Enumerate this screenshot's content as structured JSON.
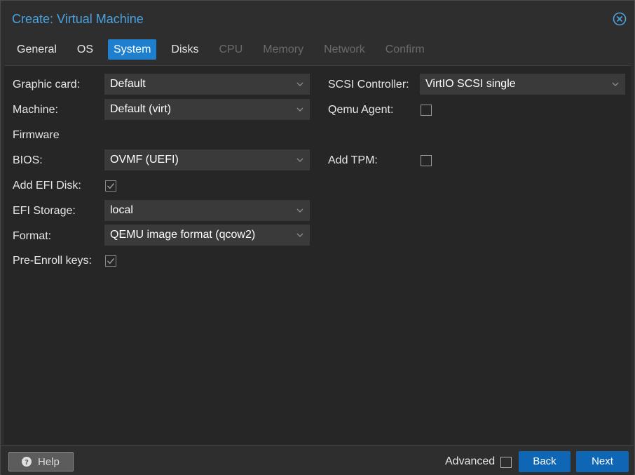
{
  "dialog": {
    "title": "Create: Virtual Machine",
    "close_icon": "close-circle-icon",
    "accent_color": "#4aa3df"
  },
  "tabs": [
    {
      "label": "General",
      "state": "normal"
    },
    {
      "label": "OS",
      "state": "normal"
    },
    {
      "label": "System",
      "state": "active"
    },
    {
      "label": "Disks",
      "state": "normal"
    },
    {
      "label": "CPU",
      "state": "disabled"
    },
    {
      "label": "Memory",
      "state": "disabled"
    },
    {
      "label": "Network",
      "state": "disabled"
    },
    {
      "label": "Confirm",
      "state": "disabled"
    }
  ],
  "form": {
    "graphic_card": {
      "label": "Graphic card:",
      "value": "Default"
    },
    "machine": {
      "label": "Machine:",
      "value": "Default (virt)"
    },
    "firmware_heading": "Firmware",
    "bios": {
      "label": "BIOS:",
      "value": "OVMF (UEFI)"
    },
    "add_efi_disk": {
      "label": "Add EFI Disk:",
      "checked": true
    },
    "efi_storage": {
      "label": "EFI Storage:",
      "value": "local"
    },
    "format": {
      "label": "Format:",
      "value": "QEMU image format (qcow2)"
    },
    "pre_enroll_keys": {
      "label": "Pre-Enroll keys:",
      "checked": true
    },
    "scsi_controller": {
      "label": "SCSI Controller:",
      "value": "VirtIO SCSI single"
    },
    "qemu_agent": {
      "label": "Qemu Agent:",
      "checked": false
    },
    "add_tpm": {
      "label": "Add TPM:",
      "checked": false
    }
  },
  "footer": {
    "help_label": "Help",
    "help_icon": "question-circle-icon",
    "advanced_label": "Advanced",
    "advanced_checked": false,
    "back_label": "Back",
    "next_label": "Next"
  }
}
